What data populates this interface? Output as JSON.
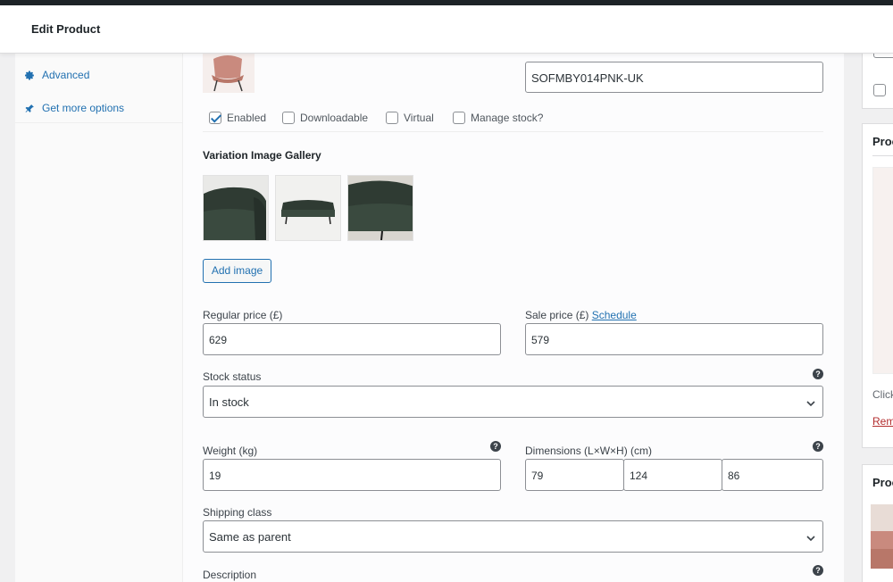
{
  "header": {
    "title": "Edit Product"
  },
  "left_nav": {
    "items": [
      {
        "label": "Advanced",
        "icon": "gear-icon"
      },
      {
        "label": "Get more options",
        "icon": "plugin-icon"
      }
    ]
  },
  "variation": {
    "sku_value": "SOFMBY014PNK-UK",
    "checkboxes": [
      {
        "label": "Enabled",
        "checked": true
      },
      {
        "label": "Downloadable",
        "checked": false
      },
      {
        "label": "Virtual",
        "checked": false
      },
      {
        "label": "Manage stock?",
        "checked": false
      }
    ],
    "gallery": {
      "label": "Variation Image Gallery",
      "add_button": "Add image"
    },
    "regular_price": {
      "label": "Regular price (£)",
      "value": "629"
    },
    "sale_price": {
      "label": "Sale price (£)",
      "schedule_link": "Schedule",
      "value": "579"
    },
    "stock_status": {
      "label": "Stock status",
      "value": "In stock"
    },
    "weight": {
      "label": "Weight (kg)",
      "value": "19"
    },
    "dimensions": {
      "label": "Dimensions (L×W×H) (cm)",
      "length": "79",
      "width": "124",
      "height": "86"
    },
    "shipping_class": {
      "label": "Shipping class",
      "value": "Same as parent"
    },
    "description": {
      "label": "Description"
    },
    "help_glyph": "?"
  },
  "right_sidebar": {
    "box1_head": "Proc",
    "box1_click": "Click",
    "box1_remove": "Rem",
    "box2_head": "Proc"
  },
  "colors": {
    "accent": "#2271b1",
    "sofa_green": "#2f3b33",
    "chair_pink": "#c98a7e"
  }
}
